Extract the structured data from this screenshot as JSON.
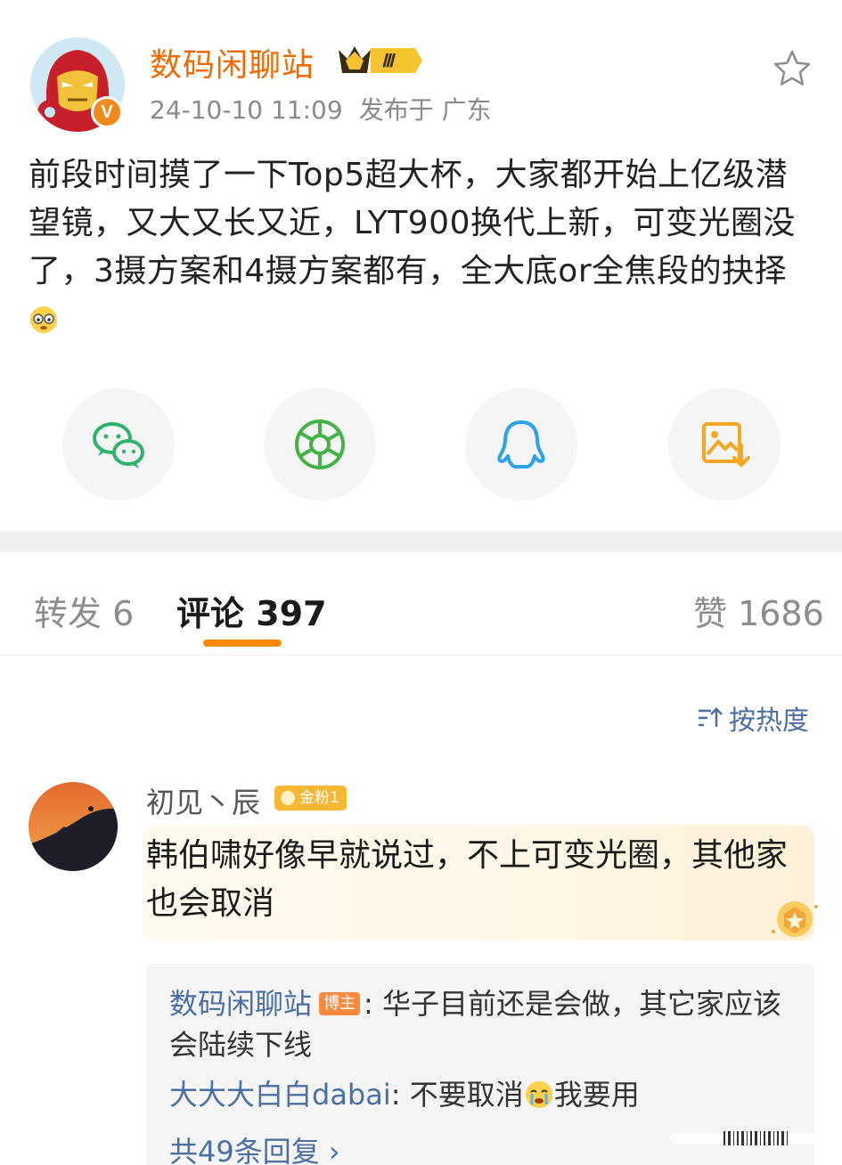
{
  "post": {
    "author_name": "数码闲聊站",
    "level_badge": "Ⅲ",
    "verified_badge": "V",
    "date": "24-10-10 11:09",
    "location": "发布于 广东",
    "text": "前段时间摸了一下Top5超大杯，大家都开始上亿级潜望镜，又大又长又近，LYT900换代上新，可变光圈没了，3摄方案和4摄方案都有，全大底or全焦段的抉择",
    "icons": {
      "favorite": "star-outline-icon",
      "text_emoji": "face-emoji-icon"
    }
  },
  "share": {
    "buttons": [
      {
        "icon": "wechat-icon",
        "color": "#2fb56b"
      },
      {
        "icon": "moments-icon",
        "color": "#43b244"
      },
      {
        "icon": "qq-icon",
        "color": "#2aa3e8"
      },
      {
        "icon": "save-image-icon",
        "color": "#f5a623"
      }
    ]
  },
  "tabs": {
    "repost": "转发 6",
    "comments": "评论 397",
    "likes": "赞 1686",
    "active": "comments",
    "accent": "#ff8a00"
  },
  "sort": {
    "label": "按热度",
    "icon": "sort-icon"
  },
  "comment": {
    "user": "初见丶辰",
    "fan_badge": "金粉1",
    "text": "韩伯啸好像早就说过，不上可变光圈，其他家也会取消",
    "replies": [
      {
        "name": "数码闲聊站",
        "tag": "博主",
        "text": ": 华子目前还是会做，其它家应该会陆续下线"
      },
      {
        "name": "大大大白白dabai",
        "tag": "",
        "text": ": 不要取消",
        "after_emoji": "我要用"
      }
    ],
    "more_replies": "共49条回复 ›"
  },
  "colors": {
    "author": "#f06a00",
    "link": "#4a6fa5",
    "meta": "#8a8a8a"
  }
}
